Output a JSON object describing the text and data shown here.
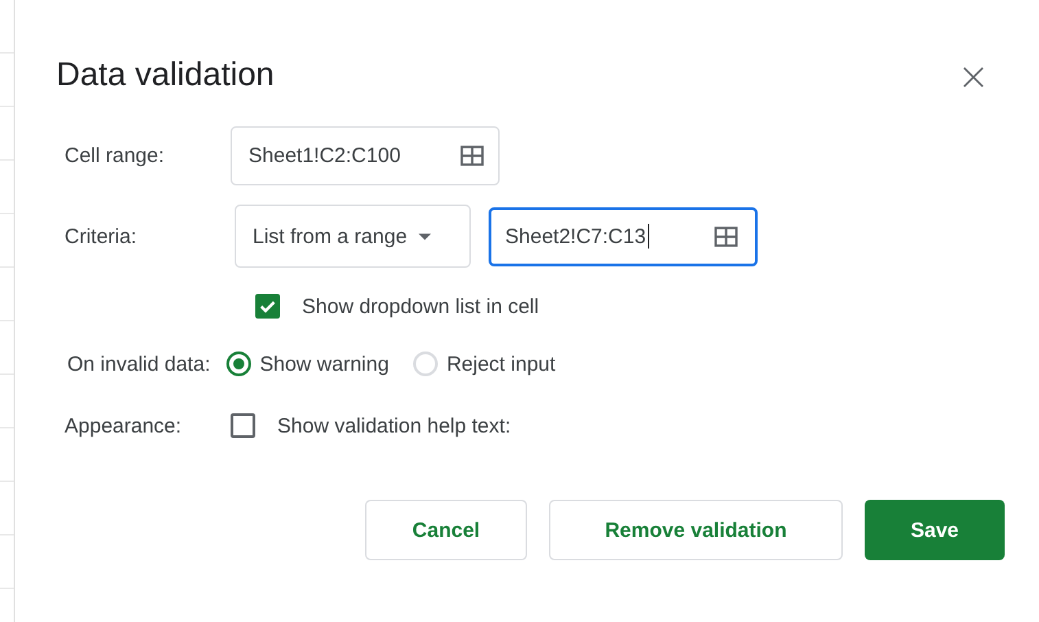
{
  "dialog": {
    "title": "Data validation",
    "close": "×"
  },
  "cell_range": {
    "label": "Cell range:",
    "value": "Sheet1!C2:C100"
  },
  "criteria": {
    "label": "Criteria:",
    "type": "List from a range",
    "value": "Sheet2!C7:C13",
    "focused": true
  },
  "show_dropdown": {
    "label": "Show dropdown list in cell",
    "checked": true
  },
  "on_invalid": {
    "label": "On invalid data:",
    "options": [
      {
        "label": "Show warning",
        "selected": true
      },
      {
        "label": "Reject input",
        "selected": false
      }
    ]
  },
  "appearance": {
    "label": "Appearance:",
    "checkbox": {
      "label": "Show validation help text:",
      "checked": false
    }
  },
  "buttons": [
    {
      "label": "Cancel",
      "kind": "secondary"
    },
    {
      "label": "Remove validation",
      "kind": "secondary"
    },
    {
      "label": "Save",
      "kind": "primary"
    }
  ]
}
